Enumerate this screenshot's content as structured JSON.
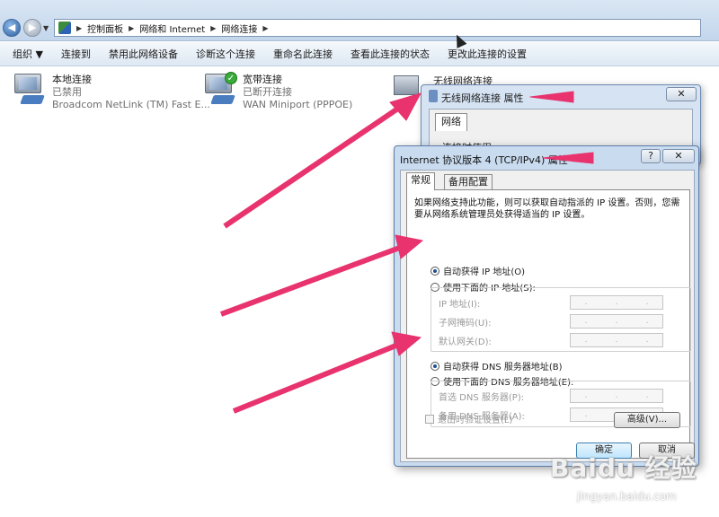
{
  "address_bar": {
    "crumbs": [
      "控制面板",
      "网络和 Internet",
      "网络连接"
    ]
  },
  "toolbar": {
    "organize": "组织 ▼",
    "connect_to": "连接到",
    "disable_device": "禁用此网络设备",
    "diagnose": "诊断这个连接",
    "rename": "重命名此连接",
    "view_status": "查看此连接的状态",
    "change_settings": "更改此连接的设置"
  },
  "connections": [
    {
      "name": "本地连接",
      "status": "已禁用",
      "device": "Broadcom NetLink (TM) Fast E..."
    },
    {
      "name": "宽带连接",
      "status": "已断开连接",
      "device": "WAN Miniport (PPPOE)"
    },
    {
      "name": "无线网络连接"
    }
  ],
  "dialog_wireless": {
    "title": "无线网络连接 属性",
    "close": "✕",
    "tab": "网络",
    "use_when": "连接时使用:"
  },
  "dialog_ipv4": {
    "title": "Internet 协议版本 4 (TCP/IPv4) 属性",
    "help": "?",
    "close": "✕",
    "tabs": [
      "常规",
      "备用配置"
    ],
    "description": "如果网络支持此功能，则可以获取自动指派的 IP 设置。否则，您需要从网络系统管理员处获得适当的 IP 设置。",
    "auto_ip": "自动获得 IP 地址(O)",
    "manual_ip": "使用下面的 IP 地址(S):",
    "ip_fields": [
      "IP 地址(I):",
      "子网掩码(U):",
      "默认网关(D):"
    ],
    "auto_dns": "自动获得 DNS 服务器地址(B)",
    "manual_dns": "使用下面的 DNS 服务器地址(E):",
    "dns_fields": [
      "首选 DNS 服务器(P):",
      "备用 DNS 服务器(A):"
    ],
    "validate": "退出时验证设置(L)",
    "advanced": "高级(V)...",
    "ok": "确定",
    "cancel": "取消"
  },
  "watermark": {
    "logo": "Baidu 经验",
    "url": "jingyan.baidu.com"
  },
  "colors": {
    "arrow": "#e8336e",
    "accent": "#2b5f9e"
  }
}
